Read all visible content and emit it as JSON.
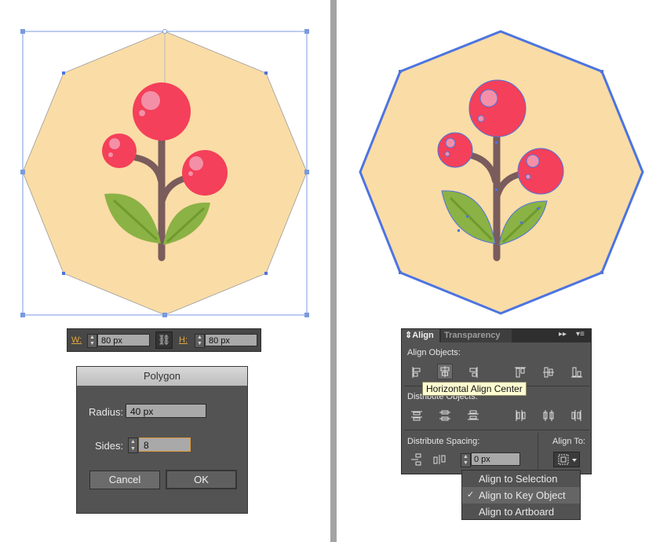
{
  "size_bar": {
    "width_label": "W:",
    "width_value": "80 px",
    "height_label": "H:",
    "height_value": "80 px"
  },
  "polygon_dialog": {
    "title": "Polygon",
    "radius_label": "Radius:",
    "radius_value": "40 px",
    "sides_label": "Sides:",
    "sides_value": "8",
    "cancel_label": "Cancel",
    "ok_label": "OK"
  },
  "align_panel": {
    "tabs": [
      {
        "label": "Align",
        "active": true
      },
      {
        "label": "Transparency",
        "active": false
      }
    ],
    "align_objects_label": "Align Objects:",
    "distribute_objects_label": "Distribute Objects:",
    "distribute_spacing_label": "Distribute Spacing:",
    "align_to_label": "Align To:",
    "spacing_value": "0 px",
    "tooltip": "Horizontal Align Center"
  },
  "align_to_menu": {
    "items": [
      {
        "label": "Align to Selection",
        "checked": false
      },
      {
        "label": "Align to Key Object",
        "checked": true
      },
      {
        "label": "Align to Artboard",
        "checked": false
      }
    ]
  },
  "colors": {
    "octagon_fill": "#fadca6",
    "berry": "#f4405a",
    "berry_highlight": "#f48fa8",
    "stem": "#7a5c5c",
    "leaf": "#8bb245",
    "leaf_vein": "#6f9a2e",
    "selection_blue": "#4c74e0",
    "panel_bg": "#535353"
  }
}
